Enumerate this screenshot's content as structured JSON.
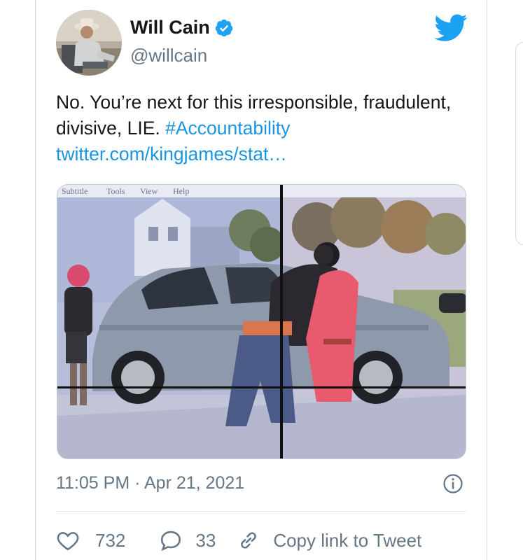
{
  "author": {
    "name": "Will Cain",
    "handle": "@willcain"
  },
  "tweet": {
    "text_main": "No. You’re next for this irresponsible, fraudulent, divisive, LIE. ",
    "hashtag": "#Accountability",
    "link": "twitter.com/kingjames/stat…"
  },
  "media": {
    "menu_bar": [
      "Subtitle",
      "Tools",
      "View",
      "Help"
    ]
  },
  "meta": {
    "timestamp": "11:05 PM · Apr 21, 2021"
  },
  "actions": {
    "likes": "732",
    "replies": "33",
    "copy_link_label": "Copy link to Tweet"
  },
  "colors": {
    "link": "#1b95e0",
    "verified": "#1da1f2",
    "twitter_brand": "#1da1f2",
    "secondary_text": "#657786"
  },
  "icons": [
    "verified-badge-icon",
    "twitter-bird-icon",
    "info-icon",
    "heart-icon",
    "reply-bubble-icon",
    "link-chain-icon"
  ]
}
